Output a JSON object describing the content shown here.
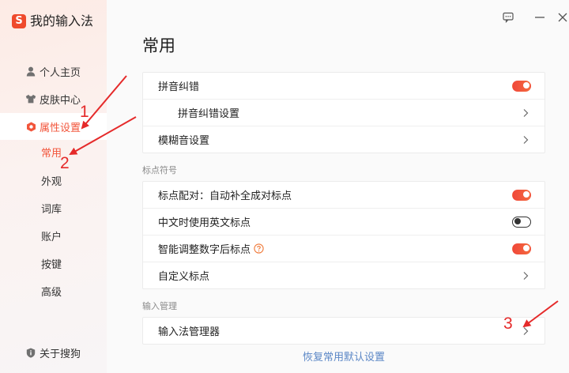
{
  "window": {
    "logo_letter": "S",
    "app_title": "我的输入法",
    "controls": {
      "feedback": "feedback-icon",
      "minimize": "minimize-icon",
      "close": "close-icon"
    }
  },
  "sidebar": {
    "items": [
      {
        "label": "个人主页",
        "icon": "person-icon",
        "active": false
      },
      {
        "label": "皮肤中心",
        "icon": "shirt-icon",
        "active": false
      },
      {
        "label": "属性设置",
        "icon": "settings-hex-icon",
        "active": true
      }
    ],
    "sub_items": [
      {
        "label": "常用",
        "active": true
      },
      {
        "label": "外观",
        "active": false
      },
      {
        "label": "词库",
        "active": false
      },
      {
        "label": "账户",
        "active": false
      },
      {
        "label": "按键",
        "active": false
      },
      {
        "label": "高级",
        "active": false
      }
    ],
    "footer": {
      "label": "关于搜狗",
      "icon": "about-shield-icon"
    }
  },
  "main": {
    "title": "常用",
    "groups": [
      {
        "rows": [
          {
            "label": "拼音纠错",
            "checked": true
          },
          {
            "label": "拼音纠错设置",
            "icon": "chevron-right-icon"
          },
          {
            "label": "模糊音设置",
            "icon": "chevron-right-icon"
          }
        ]
      },
      {
        "section_label": "标点符号",
        "rows": [
          {
            "label": "标点配对：自动补全成对标点",
            "checked": true
          },
          {
            "label": "中文时使用英文标点",
            "checked": false
          },
          {
            "label": "智能调整数字后标点",
            "checked": true,
            "help_icon": "help-icon"
          },
          {
            "label": "自定义标点",
            "icon": "chevron-right-icon"
          }
        ]
      },
      {
        "section_label": "输入管理",
        "rows": [
          {
            "label": "输入法管理器",
            "icon": "chevron-right-icon"
          }
        ]
      }
    ],
    "reset_link": "恢复常用默认设置"
  },
  "annotations": [
    {
      "label": "1"
    },
    {
      "label": "2"
    },
    {
      "label": "3"
    }
  ],
  "colors": {
    "brand": "#ef4a2c",
    "accent": "#f2553b",
    "link": "#5b87c6",
    "annotation": "#e52a2a",
    "toggle_off": "#333333"
  }
}
